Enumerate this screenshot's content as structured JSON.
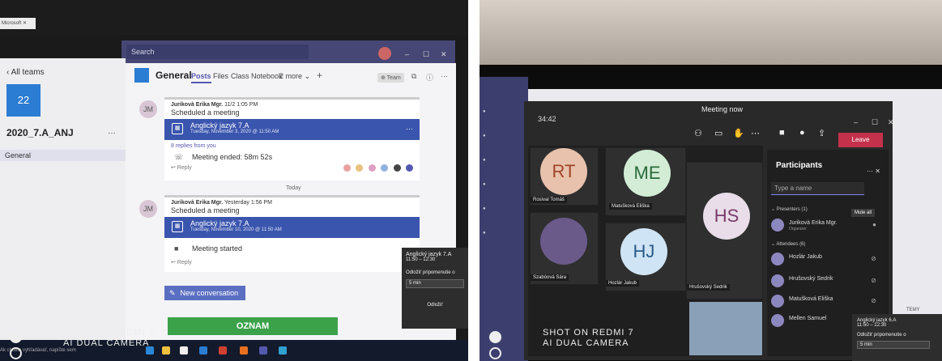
{
  "left": {
    "browser_tab": "Microsoft ✕",
    "search_placeholder": "Search",
    "window_controls": [
      "–",
      "☐",
      "✕"
    ],
    "sidebar": {
      "back_label": "All teams",
      "team_tile": "22",
      "team_name": "2020_7.A_ANJ",
      "team_more": "…",
      "channel": "General"
    },
    "channel_header": {
      "title": "General",
      "tabs": [
        "Posts",
        "Files",
        "Class Notebook",
        "2 more ⌄"
      ],
      "add": "+",
      "team_badge": "⊕ Team"
    },
    "posts": [
      {
        "initials": "JM",
        "author": "Jurikovà Erika Mgr.",
        "time": "11/2 1:05 PM",
        "action": "Scheduled a meeting",
        "meeting_title": "Anglický jazyk 7.A",
        "meeting_date": "Tuesday, November 3, 2020 @ 11:50 AM",
        "replies": "8 replies from you",
        "status": "Meeting ended: 58m 52s",
        "reply": "↩ Reply"
      },
      {
        "initials": "JM",
        "author": "Jurikovà Erika Mgr.",
        "time": "Yesterday 1:56 PM",
        "action": "Scheduled a meeting",
        "meeting_title": "Anglický jazyk 7.A",
        "meeting_date": "Tuesday, November 10, 2020 @ 11:50 AM",
        "status": "Meeting started",
        "reply": "↩ Reply"
      }
    ],
    "today_divider": "Today",
    "new_conversation": "New conversation",
    "toast": {
      "title": "Anglický jazyk 7.A",
      "time": "11:50 – 12:30",
      "snooze_label": "Odložiť pripomenutie o",
      "snooze_value": "5 min",
      "dismiss": "Odložiť"
    },
    "oznam": "OZNAM",
    "taskbar_search": "Ak chcete vyhľadávať, napíšte sem"
  },
  "right": {
    "timer": "34:42",
    "meeting_title": "Meeting now",
    "leave_label": "Leave",
    "participants_title": "Participants",
    "type_placeholder": "Type a name",
    "presenters_label": "Presenters (1)",
    "mute_all": "Mute all",
    "presenter": {
      "name": "Jurikovà Erika Mgr.",
      "role": "Organizer"
    },
    "attendees_label": "Attendees (6)",
    "attendees": [
      "Hozlár Jakub",
      "Hrušovský Sedrik",
      "Matušková Eliška",
      "Mellen Samuel"
    ],
    "tiles": [
      {
        "initials": "RT",
        "name": "Rosival Tomáš"
      },
      {
        "initials": "ME",
        "name": "Matušková Eliška"
      },
      {
        "initials": "HS",
        "name": "Hrušovský Sedrik"
      },
      {
        "initials": "",
        "name": "Szabóová Sára"
      },
      {
        "initials": "HJ",
        "name": "Hozlár Jakub"
      }
    ],
    "toast": {
      "title": "Anglický jazyk 6.A",
      "time": "11:50 – 12:30",
      "snooze_label": "Odložiť pripomenutie o",
      "snooze_value": "5 min"
    },
    "side_label": "TEMY"
  },
  "watermark": {
    "line1": "SHOT ON REDMI 7",
    "line2": "AI DUAL CAMERA"
  },
  "colors": {
    "teams_purple": "#464775",
    "meeting_blue": "#3a55ad",
    "leave_red": "#c4314b",
    "oznam_green": "#3ca24a"
  }
}
